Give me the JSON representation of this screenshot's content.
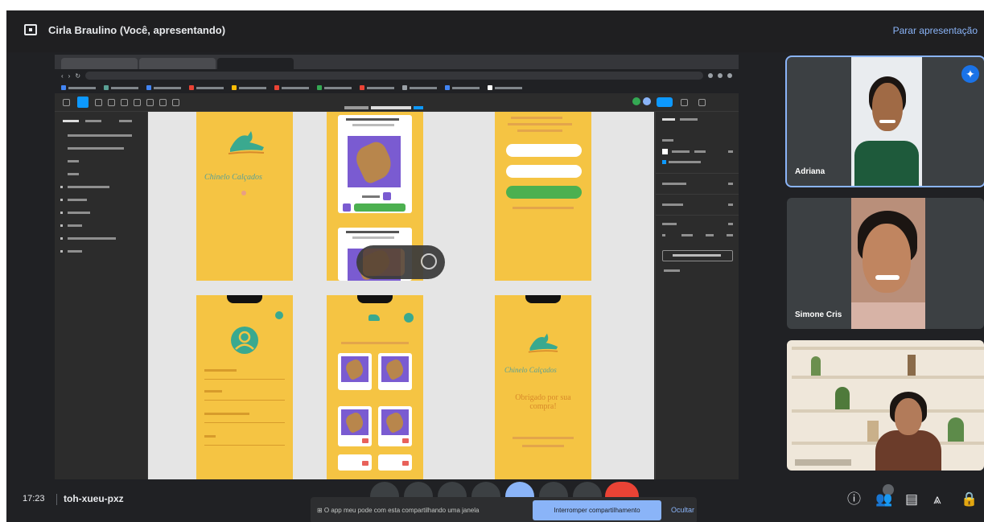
{
  "meeting": {
    "presenter_title": "Cirla Braulino (Você, apresentando)",
    "stop_presenting_label": "Parar apresentação",
    "time": "17:23",
    "code": "toh-xueu-pxz"
  },
  "participants": [
    {
      "name": "Adriana"
    },
    {
      "name": "Simone Cris"
    },
    {
      "name": ""
    }
  ],
  "notice": {
    "text": "⊞ O app meu pode com esta compartilhando uma janela",
    "primary_label": "Interromper compartilhamento",
    "dismiss_label": "Ocultar"
  },
  "shared_app": {
    "frames": [
      {
        "brand": "Chinelo Calçados"
      },
      {
        "brand": "Chinelo Calçados",
        "heading": "Obrigado por sua compra!"
      }
    ]
  },
  "colors": {
    "meet_bg": "#202124",
    "accent_blue": "#8ab4f8",
    "figma_frame": "#f5c443",
    "brand_teal": "#5aa095",
    "end_call_red": "#ea4335"
  }
}
